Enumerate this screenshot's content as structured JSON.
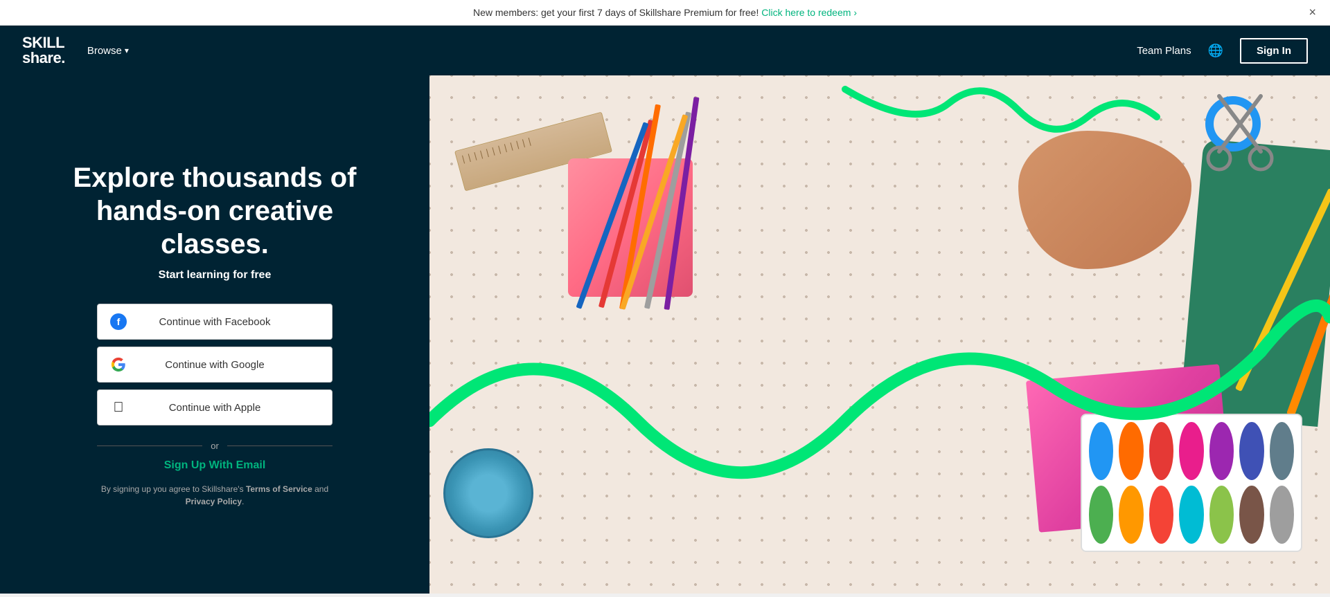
{
  "banner": {
    "text": "New members: get your first 7 days of Skillshare Premium for free!",
    "link_text": "Click here to redeem",
    "link_arrow": "›",
    "close_label": "×"
  },
  "nav": {
    "logo_line1": "SKILL",
    "logo_line2": "share.",
    "browse_label": "Browse",
    "browse_chevron": "▾",
    "team_plans_label": "Team Plans",
    "globe_icon": "🌐",
    "sign_in_label": "Sign In"
  },
  "hero": {
    "headline": "Explore thousands of hands-on creative classes.",
    "subheadline": "Start learning for free"
  },
  "auth": {
    "facebook_label": "Continue with Facebook",
    "google_label": "Continue with Google",
    "apple_label": "Continue with Apple",
    "or_text": "or",
    "email_label": "Sign Up With Email",
    "terms_prefix": "By signing up you agree to Skillshare's",
    "terms_link": "Terms of Service",
    "terms_and": "and",
    "privacy_link": "Privacy Policy",
    "terms_suffix": "."
  },
  "palette_colors": [
    "#2196F3",
    "#FF6B00",
    "#E53935",
    "#E91E8C",
    "#9C27B0",
    "#3F51B5",
    "#607D8B",
    "#4CAF50",
    "#FF9800",
    "#F44336",
    "#00BCD4",
    "#8BC34A",
    "#795548",
    "#9E9E9E"
  ]
}
